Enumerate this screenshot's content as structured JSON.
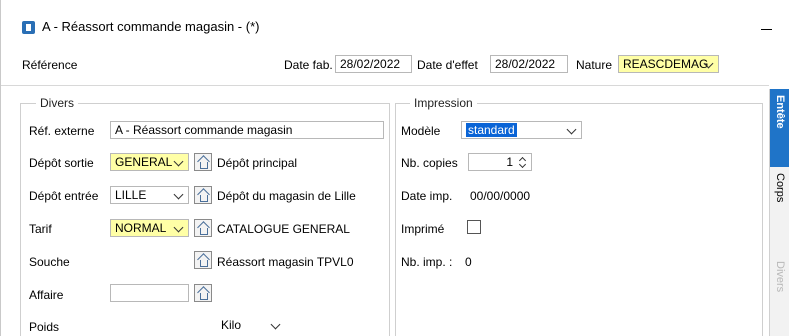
{
  "window": {
    "title": "A - Réassort commande magasin -  (*)"
  },
  "header": {
    "reference_label": "Référence",
    "date_fab_label": "Date fab.",
    "date_fab_value": "28/02/2022",
    "date_effet_label": "Date d'effet",
    "date_effet_value": "28/02/2022",
    "nature_label": "Nature",
    "nature_value": "REASCDEMAG"
  },
  "divers": {
    "title": "Divers",
    "ref_externe_label": "Réf. externe",
    "ref_externe_value": "A - Réassort commande magasin",
    "depot_sortie_label": "Dépôt sortie",
    "depot_sortie_value": "GENERAL",
    "depot_sortie_desc": "Dépôt principal",
    "depot_entree_label": "Dépôt entrée",
    "depot_entree_value": "LILLE",
    "depot_entree_desc": "Dépôt du magasin de Lille",
    "tarif_label": "Tarif",
    "tarif_value": "NORMAL",
    "tarif_desc": "CATALOGUE GENERAL",
    "souche_label": "Souche",
    "souche_desc": "Réassort magasin TPVL0",
    "affaire_label": "Affaire",
    "affaire_value": "",
    "poids_label": "Poids",
    "poids_value": "Kilo"
  },
  "impression": {
    "title": "Impression",
    "modele_label": "Modèle",
    "modele_value": "standard",
    "nb_copies_label": "Nb. copies",
    "nb_copies_value": "1",
    "date_imp_label": "Date imp.",
    "date_imp_value": "00/00/0000",
    "imprime_label": "Imprimé",
    "imprime_checked": false,
    "nb_imp_label": "Nb. imp. :",
    "nb_imp_value": "0"
  },
  "side_tabs": [
    {
      "label": "Entête",
      "active": true
    },
    {
      "label": "Corps",
      "active": false
    },
    {
      "label": "Divers",
      "active": false,
      "disabled": true
    }
  ],
  "colors": {
    "accent": "#1f74c8",
    "highlight_field": "#ffffa6",
    "selection": "#0a64d6"
  }
}
